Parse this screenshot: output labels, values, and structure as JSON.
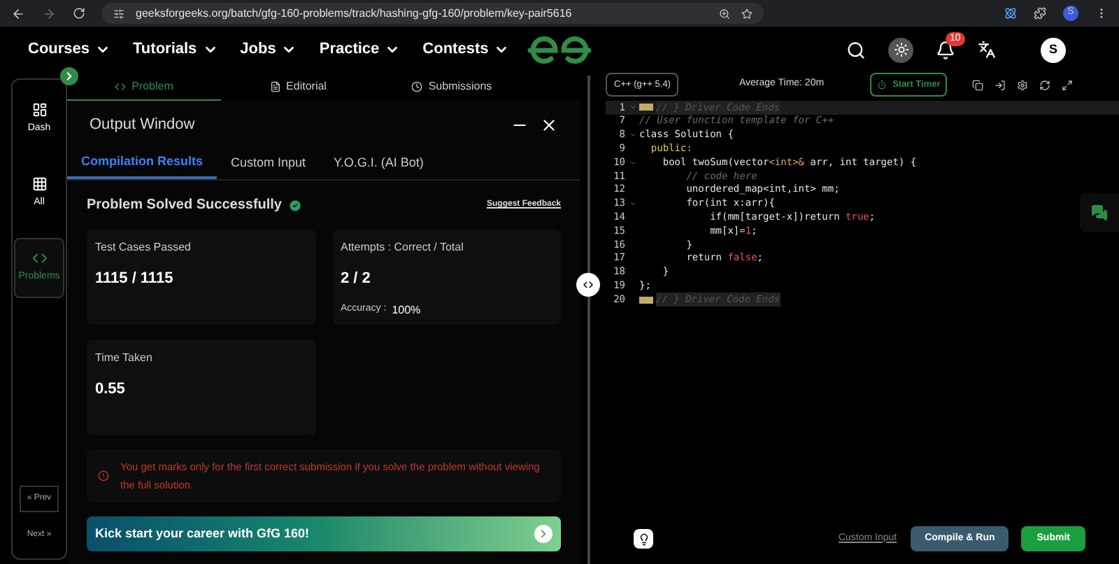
{
  "browser": {
    "url": "geeksforgeeks.org/batch/gfg-160-problems/track/hashing-gfg-160/problem/key-pair5616",
    "profile": "S"
  },
  "nav": {
    "menus": [
      "Courses",
      "Tutorials",
      "Jobs",
      "Practice",
      "Contests"
    ],
    "notifications": "10",
    "avatar": "S"
  },
  "sidebar": {
    "items": [
      {
        "label": "Dash",
        "kind": "dash",
        "selected": false
      },
      {
        "label": "All",
        "kind": "all",
        "selected": false
      },
      {
        "label": "Problems",
        "kind": "code",
        "selected": true
      }
    ],
    "prev": "« Prev",
    "next": "Next »"
  },
  "problem_tabs": [
    {
      "label": "Problem",
      "kind": "code",
      "selected": true
    },
    {
      "label": "Editorial",
      "kind": "doc",
      "selected": false
    },
    {
      "label": "Submissions",
      "kind": "clock",
      "selected": false
    }
  ],
  "output": {
    "title": "Output Window",
    "tabs": [
      {
        "label": "Compilation Results",
        "selected": true
      },
      {
        "label": "Custom Input",
        "selected": false
      },
      {
        "label": "Y.O.G.I. (AI Bot)",
        "selected": false
      }
    ],
    "status": "Problem Solved Successfully",
    "feedback": "Suggest Feedback",
    "cards": [
      {
        "label": "Test Cases Passed",
        "value": "1115 / 1115"
      },
      {
        "label": "Attempts : Correct / Total",
        "value": "2 / 2",
        "extra_label": "Accuracy :",
        "extra_value": "100%"
      },
      {
        "label": "Time Taken",
        "value": "0.55"
      }
    ],
    "warning": "You get marks only for the first correct submission if you solve the problem without viewing the full solution.",
    "banner": "Kick start your career with GfG 160!"
  },
  "editor": {
    "language": "C++ (g++ 5.4)",
    "average_time": "Average Time: 20m",
    "timer": "Start Timer",
    "lines": [
      {
        "number": "1",
        "fold": true,
        "folded": true,
        "active": true,
        "tokens": [
          {
            "text": "// } Driver Code Ends",
            "kind": "dim"
          }
        ]
      },
      {
        "number": "7",
        "fold": false,
        "folded": false,
        "active": false,
        "tokens": [
          {
            "text": "// User function template for C++",
            "kind": "comment"
          }
        ]
      },
      {
        "number": "8",
        "fold": true,
        "folded": false,
        "active": false,
        "tokens": [
          {
            "text": "class Solution {",
            "kind": "plain"
          }
        ]
      },
      {
        "number": "9",
        "fold": false,
        "folded": false,
        "active": false,
        "tokens": [
          {
            "text": "  public:",
            "kind": "keyword"
          }
        ]
      },
      {
        "number": "10",
        "fold": true,
        "folded": false,
        "active": false,
        "tokens": [
          {
            "text": "    bool twoSum(vector",
            "kind": "plain"
          },
          {
            "text": "<int>&",
            "kind": "type"
          },
          {
            "text": " arr, int target) {",
            "kind": "plain"
          }
        ]
      },
      {
        "number": "11",
        "fold": false,
        "folded": false,
        "active": false,
        "tokens": [
          {
            "text": "        // code here",
            "kind": "comment"
          }
        ]
      },
      {
        "number": "12",
        "fold": false,
        "folded": false,
        "active": false,
        "tokens": [
          {
            "text": "        unordered_map",
            "kind": "plain"
          },
          {
            "text": "<int,int>",
            "kind": "plain"
          },
          {
            "text": " mm;",
            "kind": "plain"
          }
        ]
      },
      {
        "number": "13",
        "fold": true,
        "folded": false,
        "active": false,
        "tokens": [
          {
            "text": "        for(int x:arr){",
            "kind": "plain"
          }
        ]
      },
      {
        "number": "14",
        "fold": false,
        "folded": false,
        "active": false,
        "tokens": [
          {
            "text": "            if(mm[target-x])return ",
            "kind": "plain"
          },
          {
            "text": "true",
            "kind": "literal"
          },
          {
            "text": ";",
            "kind": "plain"
          }
        ]
      },
      {
        "number": "15",
        "fold": false,
        "folded": false,
        "active": false,
        "tokens": [
          {
            "text": "            mm[x]=",
            "kind": "plain"
          },
          {
            "text": "1",
            "kind": "literal"
          },
          {
            "text": ";",
            "kind": "plain"
          }
        ]
      },
      {
        "number": "16",
        "fold": false,
        "folded": false,
        "active": false,
        "tokens": [
          {
            "text": "        }",
            "kind": "plain"
          }
        ]
      },
      {
        "number": "17",
        "fold": false,
        "folded": false,
        "active": false,
        "tokens": [
          {
            "text": "        return ",
            "kind": "plain"
          },
          {
            "text": "false",
            "kind": "literal"
          },
          {
            "text": ";",
            "kind": "plain"
          }
        ]
      },
      {
        "number": "18",
        "fold": false,
        "folded": false,
        "active": false,
        "tokens": [
          {
            "text": "    }",
            "kind": "plain"
          }
        ]
      },
      {
        "number": "19",
        "fold": false,
        "folded": false,
        "active": false,
        "tokens": [
          {
            "text": "};",
            "kind": "plain"
          }
        ]
      },
      {
        "number": "20",
        "fold": false,
        "folded": true,
        "active": false,
        "tokens": [
          {
            "text": "// } Driver Code Ends",
            "kind": "dim"
          }
        ]
      }
    ],
    "custom_input": "Custom Input",
    "compile": "Compile & Run",
    "submit": "Submit"
  }
}
